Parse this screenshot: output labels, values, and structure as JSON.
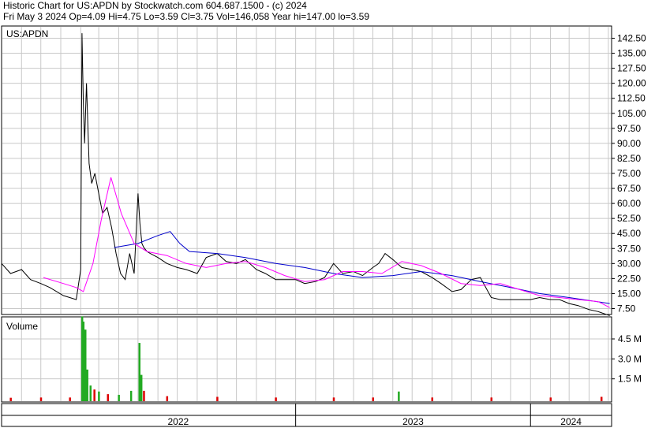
{
  "header": {
    "line1": "Historic Chart for US:APDN by Stockwatch.com 604.687.1500 - (c) 2024",
    "line2": "Fri May  3 2024   Op=4.09   Hi=4.75   Lo=3.59   Cl=3.75   Vol=146,058   Year hi=147.00   lo=3.59"
  },
  "chart_data": [
    {
      "type": "line",
      "panel": "price",
      "symbol_label": "US:APDN",
      "ylim": [
        0,
        147
      ],
      "yticks": [
        "142.50",
        "135.00",
        "127.50",
        "120.00",
        "112.50",
        "105.00",
        "97.50",
        "90.00",
        "82.50",
        "75.00",
        "67.50",
        "60.00",
        "52.50",
        "45.00",
        "37.50",
        "30.00",
        "22.50",
        "15.00",
        "7.50"
      ],
      "ytick_values": [
        142.5,
        135,
        127.5,
        120,
        112.5,
        105,
        97.5,
        90,
        82.5,
        75,
        67.5,
        60,
        52.5,
        45,
        37.5,
        30,
        22.5,
        15,
        7.5
      ],
      "x_labels": [
        "2022",
        "2023",
        "2024"
      ],
      "grid": true,
      "colors": {
        "price": "#000000",
        "ma_short": "#ff00ff",
        "ma_long": "#0000cc",
        "grid": "#c8c8c8"
      },
      "series": [
        {
          "role": "price",
          "x": [
            "2021-10-01",
            "2021-10-15",
            "2021-11-01",
            "2021-11-15",
            "2021-12-01",
            "2021-12-15",
            "2022-01-05",
            "2022-01-15",
            "2022-01-25",
            "2022-02-01",
            "2022-02-03",
            "2022-02-05",
            "2022-02-07",
            "2022-02-10",
            "2022-02-14",
            "2022-02-18",
            "2022-02-23",
            "2022-03-01",
            "2022-03-07",
            "2022-03-14",
            "2022-03-21",
            "2022-03-28",
            "2022-04-04",
            "2022-04-11",
            "2022-04-18",
            "2022-04-25",
            "2022-05-01",
            "2022-05-04",
            "2022-05-07",
            "2022-05-10",
            "2022-05-15",
            "2022-05-20",
            "2022-06-01",
            "2022-06-15",
            "2022-07-01",
            "2022-07-15",
            "2022-08-01",
            "2022-08-15",
            "2022-09-01",
            "2022-09-15",
            "2022-10-01",
            "2022-10-15",
            "2022-11-01",
            "2022-11-15",
            "2022-12-01",
            "2022-12-15",
            "2023-01-01",
            "2023-01-15",
            "2023-02-01",
            "2023-02-15",
            "2023-03-01",
            "2023-03-15",
            "2023-04-01",
            "2023-04-15",
            "2023-05-01",
            "2023-05-10",
            "2023-05-20",
            "2023-06-01",
            "2023-06-15",
            "2023-07-01",
            "2023-07-15",
            "2023-08-01",
            "2023-08-15",
            "2023-09-01",
            "2023-09-15",
            "2023-10-01",
            "2023-10-15",
            "2023-11-01",
            "2023-11-15",
            "2023-12-01",
            "2023-12-15",
            "2024-01-01",
            "2024-01-15",
            "2024-02-01",
            "2024-02-15",
            "2024-03-01",
            "2024-03-15",
            "2024-04-01",
            "2024-04-15",
            "2024-05-03"
          ],
          "values": [
            30,
            25,
            27,
            22,
            20,
            18,
            14,
            13,
            12,
            27,
            145,
            110,
            90,
            120,
            80,
            70,
            75,
            65,
            55,
            58,
            48,
            35,
            25,
            22,
            35,
            25,
            65,
            50,
            40,
            38,
            36,
            35,
            33,
            30,
            28,
            27,
            25,
            33,
            35,
            31,
            30,
            32,
            27,
            25,
            22,
            22,
            22,
            20,
            21,
            23,
            30,
            25,
            26,
            24,
            28,
            30,
            35,
            32,
            28,
            27,
            26,
            23,
            20,
            16,
            17,
            22,
            23,
            13,
            12,
            12,
            12,
            12,
            13,
            12,
            12,
            10,
            9,
            7,
            6,
            4
          ]
        },
        {
          "role": "ma_short",
          "x": [
            "2021-12-05",
            "2022-01-05",
            "2022-01-25",
            "2022-02-05",
            "2022-02-20",
            "2022-03-05",
            "2022-03-20",
            "2022-04-05",
            "2022-04-25",
            "2022-05-15",
            "2022-06-15",
            "2022-07-15",
            "2022-08-15",
            "2022-09-15",
            "2022-10-15",
            "2022-11-15",
            "2022-12-15",
            "2023-01-15",
            "2023-02-15",
            "2023-03-15",
            "2023-04-15",
            "2023-05-15",
            "2023-06-15",
            "2023-07-15",
            "2023-08-15",
            "2023-09-15",
            "2023-10-15",
            "2023-11-15",
            "2023-12-15",
            "2024-01-15",
            "2024-02-15",
            "2024-03-15",
            "2024-04-15",
            "2024-05-03"
          ],
          "values": [
            23,
            20,
            18,
            16,
            30,
            52,
            73,
            55,
            40,
            36,
            34,
            30,
            28,
            30,
            31,
            28,
            24,
            21,
            22,
            26,
            26,
            25,
            31,
            29,
            25,
            20,
            19,
            20,
            17,
            14,
            13,
            12,
            11,
            8
          ]
        },
        {
          "role": "ma_long",
          "x": [
            "2022-03-25",
            "2022-05-01",
            "2022-06-01",
            "2022-06-20",
            "2022-07-05",
            "2022-07-20",
            "2022-09-01",
            "2022-10-15",
            "2022-12-01",
            "2023-01-15",
            "2023-03-01",
            "2023-04-15",
            "2023-06-01",
            "2023-07-15",
            "2023-09-01",
            "2023-10-15",
            "2023-12-01",
            "2024-01-15",
            "2024-03-01",
            "2024-05-03"
          ],
          "values": [
            38,
            40,
            44,
            46,
            40,
            36,
            35,
            33,
            30,
            28,
            25,
            23,
            24,
            26,
            24,
            21,
            18,
            15,
            13,
            10
          ]
        }
      ]
    },
    {
      "type": "bar",
      "panel": "volume",
      "ylabel": "Volume",
      "ylim": [
        0,
        6
      ],
      "yticks": [
        "4.5 M",
        "3.0 M",
        "1.5 M"
      ],
      "ytick_values": [
        4.5,
        3.0,
        1.5
      ],
      "unit": "M",
      "colors": {
        "up": "#22aa22",
        "down": "#dd0000"
      },
      "series": [
        {
          "name": "",
          "x": [
            "2021-10-15",
            "2021-12-01",
            "2022-01-15",
            "2022-02-03",
            "2022-02-05",
            "2022-02-08",
            "2022-02-11",
            "2022-02-16",
            "2022-02-22",
            "2022-03-01",
            "2022-03-15",
            "2022-04-01",
            "2022-04-20",
            "2022-05-03",
            "2022-05-06",
            "2022-05-10",
            "2022-06-15",
            "2022-09-01",
            "2022-12-01",
            "2023-03-01",
            "2023-05-01",
            "2023-06-10",
            "2023-08-01",
            "2023-11-01",
            "2024-02-01",
            "2024-04-20"
          ],
          "values": [
            0.08,
            0.1,
            0.1,
            6.2,
            5.8,
            5.2,
            2.2,
            1.0,
            0.7,
            0.55,
            0.35,
            0.3,
            0.6,
            4.2,
            1.8,
            0.6,
            0.2,
            0.15,
            0.1,
            0.1,
            0.1,
            0.55,
            0.1,
            0.1,
            0.1,
            0.15
          ],
          "direction": [
            "down",
            "down",
            "down",
            "up",
            "up",
            "up",
            "up",
            "up",
            "down",
            "up",
            "down",
            "up",
            "up",
            "up",
            "up",
            "down",
            "down",
            "down",
            "down",
            "down",
            "down",
            "up",
            "down",
            "down",
            "down",
            "down"
          ]
        }
      ]
    }
  ]
}
